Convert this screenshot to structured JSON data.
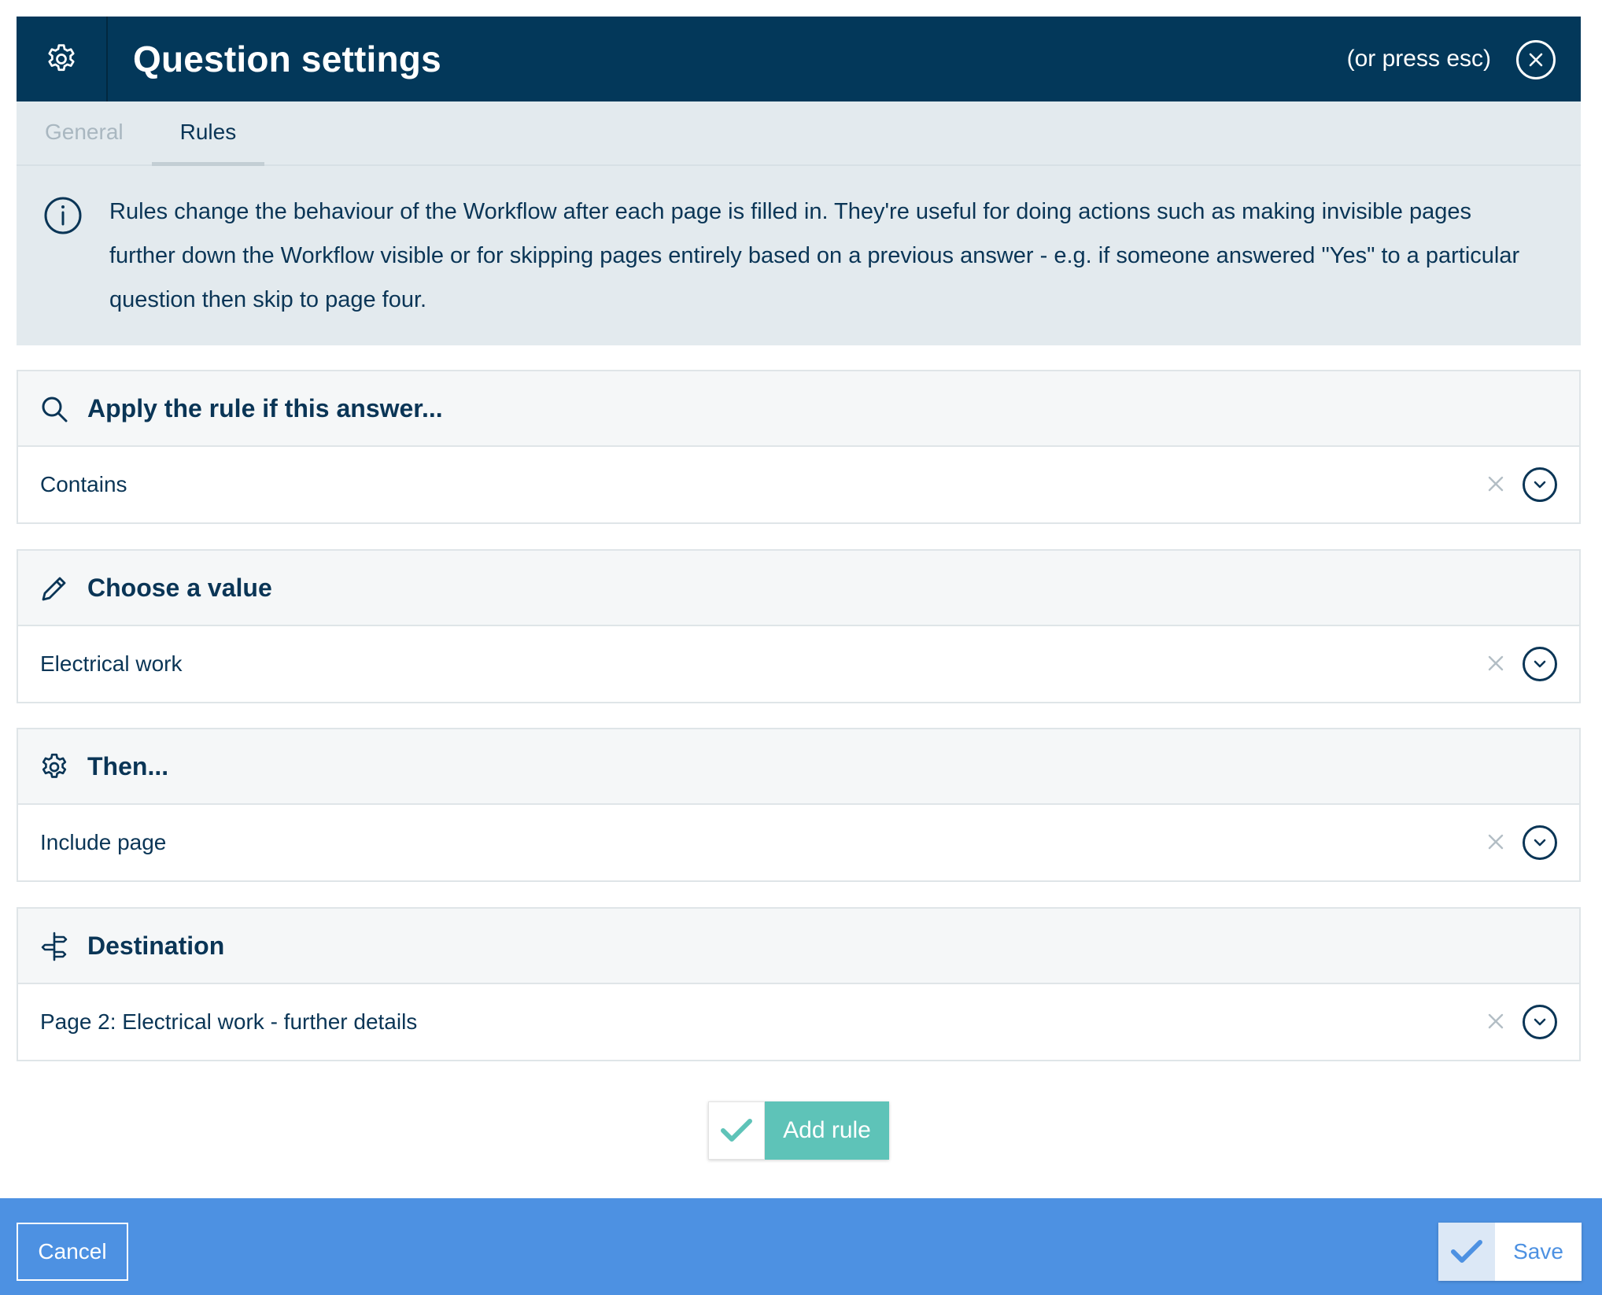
{
  "header": {
    "title": "Question settings",
    "hint": "(or press esc)",
    "icon": "gear-icon",
    "close_icon": "close-icon"
  },
  "tabs": [
    {
      "label": "General",
      "active": false
    },
    {
      "label": "Rules",
      "active": true
    }
  ],
  "info": {
    "icon": "info-icon",
    "text": "Rules change the behaviour of the Workflow after each page is filled in. They're useful for doing actions such as making invisible pages further down the Workflow visible or for skipping pages entirely based on a previous answer - e.g. if someone answered \"Yes\" to a particular question then skip to page four."
  },
  "sections": [
    {
      "title": "Apply the rule if this answer...",
      "icon": "search-icon",
      "value": "Contains"
    },
    {
      "title": "Choose a value",
      "icon": "pencil-icon",
      "value": "Electrical work"
    },
    {
      "title": "Then...",
      "icon": "gear-icon",
      "value": "Include page"
    },
    {
      "title": "Destination",
      "icon": "signpost-icon",
      "value": "Page 2: Electrical work - further details"
    }
  ],
  "add_rule": {
    "label": "Add rule",
    "icon": "check-icon"
  },
  "footer": {
    "cancel_label": "Cancel",
    "save_label": "Save",
    "save_icon": "check-icon"
  },
  "colors": {
    "header_bg": "#03385a",
    "panel_bg": "#e3eaee",
    "accent_teal": "#5ec3b8",
    "footer_bg": "#4d91e2",
    "text_dark": "#0a3556"
  }
}
